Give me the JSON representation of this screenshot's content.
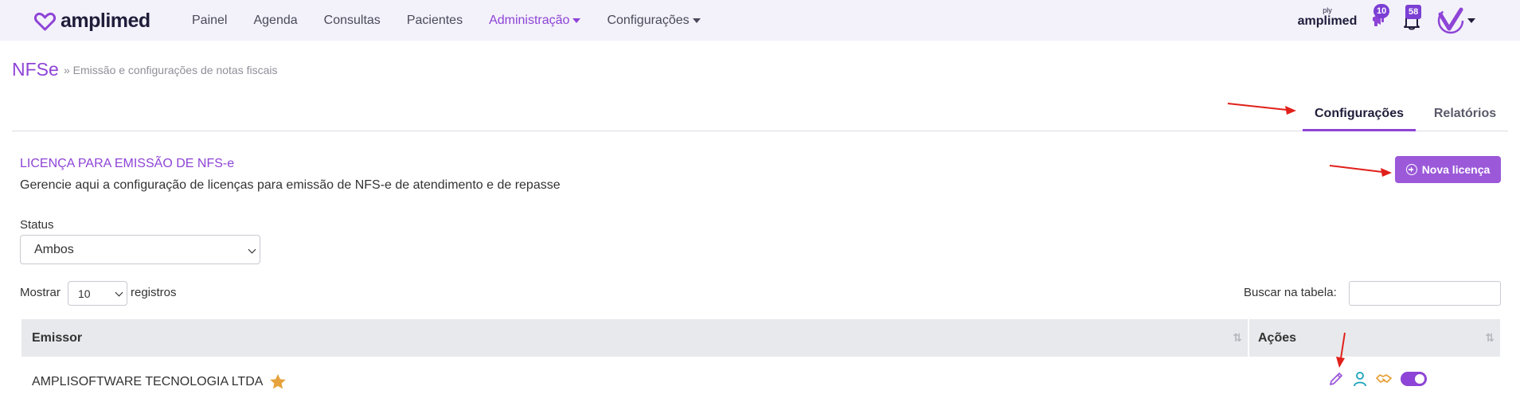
{
  "navbar": {
    "logo_text": "amplimed",
    "links": [
      {
        "label": "Painel",
        "active": false,
        "dropdown": false
      },
      {
        "label": "Agenda",
        "active": false,
        "dropdown": false
      },
      {
        "label": "Consultas",
        "active": false,
        "dropdown": false
      },
      {
        "label": "Pacientes",
        "active": false,
        "dropdown": false
      },
      {
        "label": "Administração",
        "active": true,
        "dropdown": true
      },
      {
        "label": "Configurações",
        "active": false,
        "dropdown": true
      }
    ],
    "brand_small_top": "ply",
    "brand_small_bottom": "amplimed",
    "notifications_count": "10",
    "alerts_count": "58"
  },
  "header": {
    "title": "NFSe",
    "subtitle": "» Emissão e configurações de notas fiscais"
  },
  "tabs": [
    {
      "label": "Configurações",
      "active": true
    },
    {
      "label": "Relatórios",
      "active": false
    }
  ],
  "section": {
    "title": "LICENÇA PARA EMISSÃO DE NFS-e",
    "description": "Gerencie aqui a configuração de licenças para emissão de NFS-e de atendimento e de repasse",
    "new_license_label": "Nova licença"
  },
  "filters": {
    "status_label": "Status",
    "status_value": "Ambos",
    "show_label": "Mostrar",
    "show_value": "10",
    "records_label": "registros",
    "search_label": "Buscar na tabela:"
  },
  "table": {
    "columns": [
      "Emissor",
      "Ações"
    ],
    "rows": [
      {
        "emissor": "AMPLISOFTWARE TECNOLOGIA LTDA",
        "favorite": true,
        "active": true
      }
    ]
  },
  "colors": {
    "accent": "#8e44d6",
    "button": "#9b59d9",
    "star": "#e6a23c",
    "annotation_arrow": "#e0201b"
  }
}
